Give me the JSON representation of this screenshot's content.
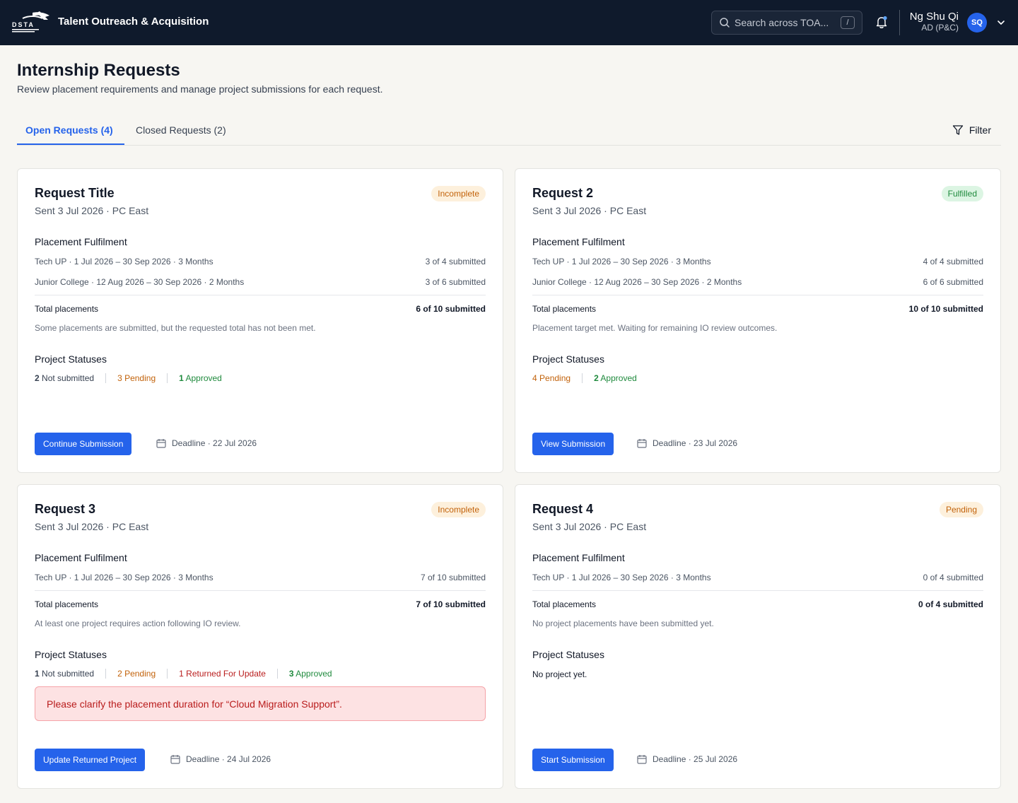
{
  "header": {
    "app_title": "Talent Outreach & Acquisition",
    "search_placeholder": "Search across TOA...",
    "search_shortcut": "/",
    "user_name": "Ng Shu Qi",
    "user_role": "AD (P&C)",
    "user_initials": "SQ"
  },
  "page": {
    "title": "Internship Requests",
    "subtitle": "Review placement requirements and manage project submissions for each request."
  },
  "tabs": {
    "open": "Open Requests (4)",
    "closed": "Closed Requests (2)",
    "filter": "Filter"
  },
  "labels": {
    "placement_fulfilment": "Placement Fulfilment",
    "total_placements": "Total placements",
    "project_statuses": "Project Statuses"
  },
  "cards": [
    {
      "title": "Request Title",
      "meta": "Sent 3 Jul 2026 · PC East",
      "badge": "Incomplete",
      "placements": [
        {
          "label": "Tech UP · 1 Jul 2026 – 30 Sep 2026  · 3 Months",
          "value": "3 of 4 submitted"
        },
        {
          "label": "Junior College · 12 Aug 2026 – 30 Sep 2026  · 2 Months",
          "value": "3 of 6 submitted"
        }
      ],
      "total": "6 of 10 submitted",
      "note": "Some placements are submitted, but the requested total has not been met.",
      "statuses": [
        {
          "count": "2",
          "label": " Not submitted"
        },
        {
          "count": "3",
          "label": " Pending"
        },
        {
          "count": "1",
          "label": " Approved"
        }
      ],
      "button": "Continue Submission",
      "deadline": "Deadline · 22 Jul 2026"
    },
    {
      "title": "Request 2",
      "meta": "Sent 3 Jul 2026 · PC East",
      "badge": "Fulfilled",
      "placements": [
        {
          "label": "Tech UP · 1 Jul 2026 – 30 Sep 2026  · 3 Months",
          "value": "4 of 4 submitted"
        },
        {
          "label": "Junior College · 12 Aug 2026 – 30 Sep 2026  · 2 Months",
          "value": "6 of 6 submitted"
        }
      ],
      "total": "10 of 10 submitted",
      "note": "Placement target met. Waiting for remaining IO review outcomes.",
      "statuses": [
        {
          "count": "4",
          "label": " Pending"
        },
        {
          "count": "2",
          "label": " Approved"
        }
      ],
      "button": "View Submission",
      "deadline": "Deadline · 23 Jul 2026"
    },
    {
      "title": "Request 3",
      "meta": "Sent 3 Jul 2026 · PC East",
      "badge": "Incomplete",
      "placements": [
        {
          "label": "Tech UP · 1 Jul 2026 – 30 Sep 2026  · 3 Months",
          "value": "7 of 10 submitted"
        }
      ],
      "total": "7 of 10 submitted",
      "note": "At least one project requires action following IO review.",
      "statuses": [
        {
          "count": "1",
          "label": " Not submitted"
        },
        {
          "count": "2",
          "label": " Pending"
        },
        {
          "count": "1",
          "label": " Returned For Update"
        },
        {
          "count": "3",
          "label": " Approved"
        }
      ],
      "alert": "Please clarify the placement duration for “Cloud Migration Support”.",
      "button": "Update Returned Project",
      "deadline": "Deadline · 24 Jul 2026"
    },
    {
      "title": "Request 4",
      "meta": "Sent 3 Jul 2026 · PC East",
      "badge": "Pending",
      "placements": [
        {
          "label": "Tech UP · 1 Jul 2026 – 30 Sep 2026  · 3 Months",
          "value": "0 of 4 submitted"
        }
      ],
      "total": "0 of 4 submitted",
      "note": "No project placements have been submitted yet.",
      "no_project": "No project yet.",
      "button": "Start Submission",
      "deadline": "Deadline · 25 Jul 2026"
    }
  ]
}
